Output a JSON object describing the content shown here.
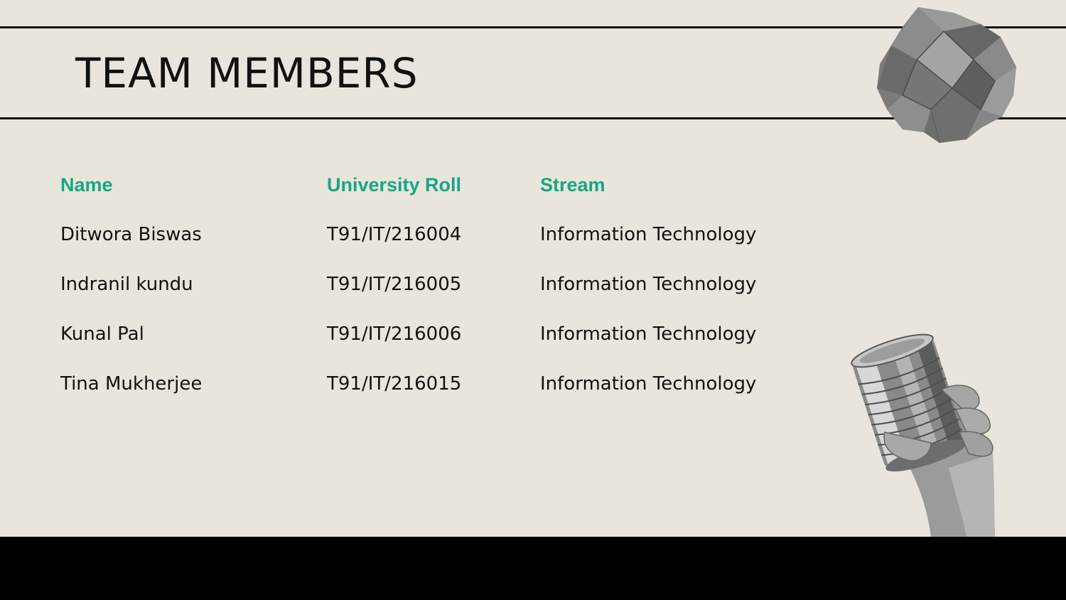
{
  "slide": {
    "title": "TEAM MEMBERS"
  },
  "table": {
    "headers": {
      "name": "Name",
      "roll": "University Roll",
      "stream": "Stream"
    },
    "rows": [
      {
        "name": "Ditwora Biswas",
        "roll": "T91/IT/216004",
        "stream": "Information Technology"
      },
      {
        "name": "Indranil kundu",
        "roll": "T91/IT/216005",
        "stream": "Information Technology"
      },
      {
        "name": "Kunal Pal",
        "roll": "T91/IT/216006",
        "stream": "Information Technology"
      },
      {
        "name": "Tina Mukherjee",
        "roll": "T91/IT/216015",
        "stream": "Information Technology"
      }
    ]
  },
  "colors": {
    "background": "#e9e5dc",
    "header_accent": "#14a882",
    "text": "#111111",
    "bottom_band": "#000000"
  },
  "images": {
    "top_right": "crumpled-paper-ball",
    "bottom_right": "hand-holding-tin-can"
  }
}
